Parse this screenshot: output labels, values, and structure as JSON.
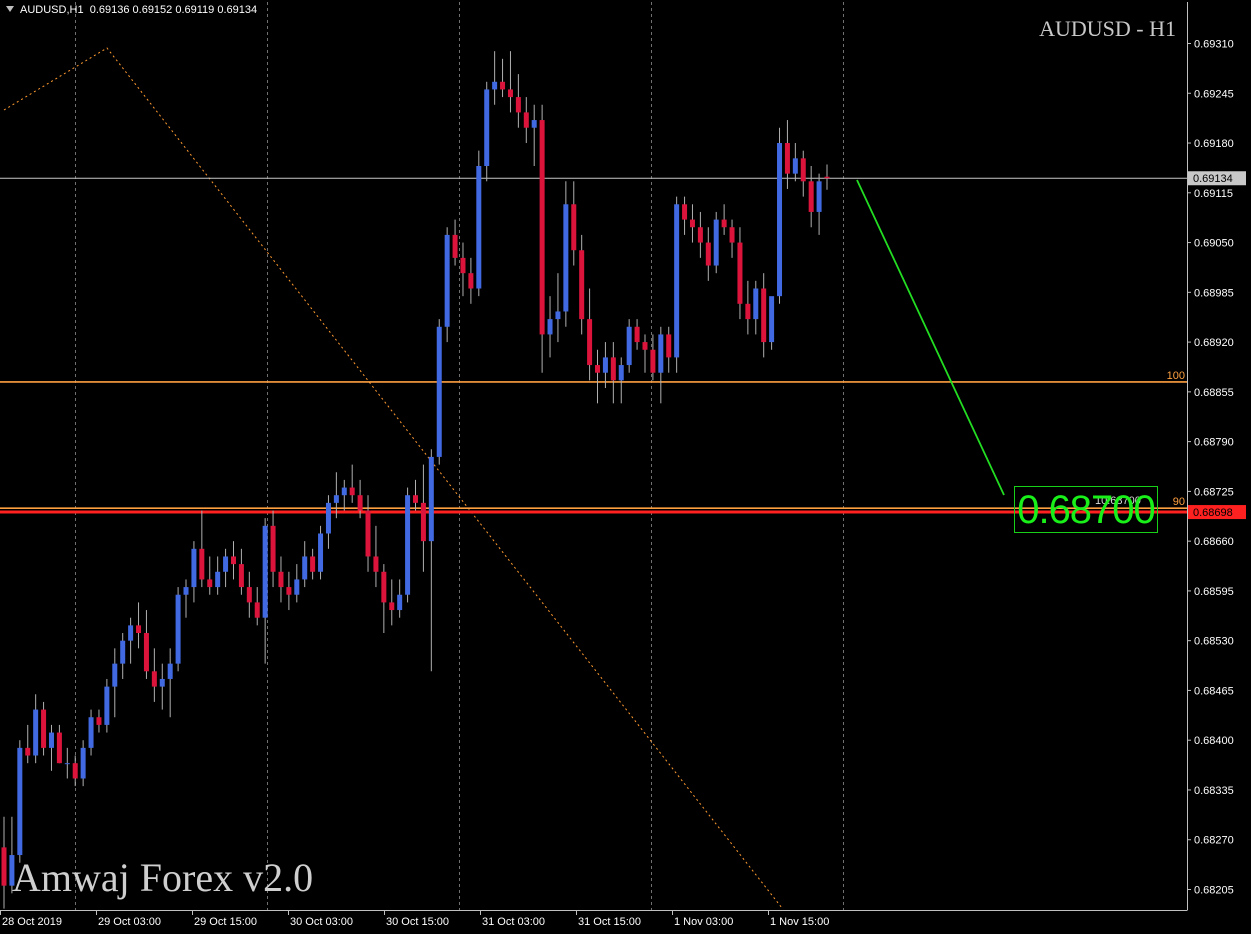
{
  "header": {
    "symbol_timeframe": "AUDUSD,H1",
    "ohlc": "0.69136 0.69152 0.69119 0.69134"
  },
  "chart_title": "AUDUSD - H1",
  "brand": "Amwaj Forex v2.0",
  "target": {
    "value": "0.68700",
    "small_label": "10.68700"
  },
  "colors": {
    "background": "#000000",
    "bull": "#4169e1",
    "bear": "#dc143c",
    "wick": "#b0b0b0",
    "grid": "#707070",
    "fib_line": "#ffa040",
    "red_line": "#ff2020",
    "projection": "#22dd22",
    "dotted_trend": "#ff9a30"
  },
  "chart_data": {
    "type": "candlestick",
    "symbol": "AUDUSD",
    "timeframe": "H1",
    "title": "AUDUSD - H1",
    "ylim": [
      0.68175,
      0.69355
    ],
    "y_ticks": [
      "0.69310",
      "0.69245",
      "0.69180",
      "0.69115",
      "0.69050",
      "0.68985",
      "0.68920",
      "0.68855",
      "0.68790",
      "0.68725",
      "0.68660",
      "0.68595",
      "0.68530",
      "0.68465",
      "0.68400",
      "0.68335",
      "0.68270",
      "0.68205"
    ],
    "x_ticks": [
      "28 Oct 2019",
      "29 Oct 03:00",
      "29 Oct 15:00",
      "30 Oct 03:00",
      "30 Oct 15:00",
      "31 Oct 03:00",
      "31 Oct 15:00",
      "1 Nov 03:00",
      "1 Nov 15:00"
    ],
    "grid": "vertical dotted",
    "bid_price": "0.69134",
    "horizontal_levels": [
      {
        "label": "100",
        "price": 0.68868,
        "color": "#ffa040"
      },
      {
        "label": "90",
        "price": 0.68703,
        "color": "#ffa040"
      },
      {
        "label": "0.68698",
        "price": 0.68698,
        "color": "#ff2020"
      }
    ],
    "candles": [
      {
        "o": 0.6826,
        "h": 0.683,
        "l": 0.6818,
        "c": 0.6821
      },
      {
        "o": 0.6821,
        "h": 0.683,
        "l": 0.682,
        "c": 0.6825
      },
      {
        "o": 0.6825,
        "h": 0.684,
        "l": 0.6824,
        "c": 0.6839
      },
      {
        "o": 0.6839,
        "h": 0.6842,
        "l": 0.6837,
        "c": 0.6838
      },
      {
        "o": 0.6838,
        "h": 0.6846,
        "l": 0.6837,
        "c": 0.6844
      },
      {
        "o": 0.6844,
        "h": 0.6845,
        "l": 0.6838,
        "c": 0.6839
      },
      {
        "o": 0.6839,
        "h": 0.6842,
        "l": 0.6836,
        "c": 0.6841
      },
      {
        "o": 0.6841,
        "h": 0.6842,
        "l": 0.6837,
        "c": 0.6837
      },
      {
        "o": 0.6837,
        "h": 0.6839,
        "l": 0.6835,
        "c": 0.6837
      },
      {
        "o": 0.6837,
        "h": 0.6838,
        "l": 0.6834,
        "c": 0.6835
      },
      {
        "o": 0.6835,
        "h": 0.684,
        "l": 0.6834,
        "c": 0.6839
      },
      {
        "o": 0.6839,
        "h": 0.6844,
        "l": 0.6838,
        "c": 0.6843
      },
      {
        "o": 0.6843,
        "h": 0.6844,
        "l": 0.6841,
        "c": 0.6842
      },
      {
        "o": 0.6842,
        "h": 0.6848,
        "l": 0.6841,
        "c": 0.6847
      },
      {
        "o": 0.6847,
        "h": 0.6852,
        "l": 0.6843,
        "c": 0.685
      },
      {
        "o": 0.685,
        "h": 0.6854,
        "l": 0.6848,
        "c": 0.6853
      },
      {
        "o": 0.6853,
        "h": 0.6856,
        "l": 0.685,
        "c": 0.6855
      },
      {
        "o": 0.6855,
        "h": 0.6858,
        "l": 0.6852,
        "c": 0.6854
      },
      {
        "o": 0.6854,
        "h": 0.6857,
        "l": 0.6848,
        "c": 0.6849
      },
      {
        "o": 0.6849,
        "h": 0.6852,
        "l": 0.6845,
        "c": 0.6847
      },
      {
        "o": 0.6847,
        "h": 0.685,
        "l": 0.6844,
        "c": 0.6848
      },
      {
        "o": 0.6848,
        "h": 0.6852,
        "l": 0.6843,
        "c": 0.685
      },
      {
        "o": 0.685,
        "h": 0.686,
        "l": 0.6849,
        "c": 0.6859
      },
      {
        "o": 0.6859,
        "h": 0.6861,
        "l": 0.6856,
        "c": 0.686
      },
      {
        "o": 0.686,
        "h": 0.6866,
        "l": 0.6858,
        "c": 0.6865
      },
      {
        "o": 0.6865,
        "h": 0.687,
        "l": 0.686,
        "c": 0.6861
      },
      {
        "o": 0.6861,
        "h": 0.6864,
        "l": 0.6859,
        "c": 0.686
      },
      {
        "o": 0.686,
        "h": 0.6864,
        "l": 0.6859,
        "c": 0.6862
      },
      {
        "o": 0.6862,
        "h": 0.6865,
        "l": 0.686,
        "c": 0.6864
      },
      {
        "o": 0.6864,
        "h": 0.6866,
        "l": 0.6861,
        "c": 0.6863
      },
      {
        "o": 0.6863,
        "h": 0.6865,
        "l": 0.6859,
        "c": 0.686
      },
      {
        "o": 0.686,
        "h": 0.6862,
        "l": 0.6856,
        "c": 0.6858
      },
      {
        "o": 0.6858,
        "h": 0.686,
        "l": 0.6855,
        "c": 0.6856
      },
      {
        "o": 0.6856,
        "h": 0.6869,
        "l": 0.685,
        "c": 0.6868
      },
      {
        "o": 0.6868,
        "h": 0.687,
        "l": 0.686,
        "c": 0.6862
      },
      {
        "o": 0.6862,
        "h": 0.6864,
        "l": 0.6858,
        "c": 0.686
      },
      {
        "o": 0.686,
        "h": 0.6862,
        "l": 0.6857,
        "c": 0.6859
      },
      {
        "o": 0.6859,
        "h": 0.6863,
        "l": 0.6858,
        "c": 0.6861
      },
      {
        "o": 0.6861,
        "h": 0.6866,
        "l": 0.686,
        "c": 0.6864
      },
      {
        "o": 0.6864,
        "h": 0.6865,
        "l": 0.6861,
        "c": 0.6862
      },
      {
        "o": 0.6862,
        "h": 0.6868,
        "l": 0.6861,
        "c": 0.6867
      },
      {
        "o": 0.6867,
        "h": 0.6872,
        "l": 0.6865,
        "c": 0.6871
      },
      {
        "o": 0.6871,
        "h": 0.6875,
        "l": 0.6869,
        "c": 0.6872
      },
      {
        "o": 0.6872,
        "h": 0.6874,
        "l": 0.687,
        "c": 0.6873
      },
      {
        "o": 0.6873,
        "h": 0.6876,
        "l": 0.6871,
        "c": 0.6872
      },
      {
        "o": 0.6872,
        "h": 0.6874,
        "l": 0.6869,
        "c": 0.687
      },
      {
        "o": 0.687,
        "h": 0.6872,
        "l": 0.6862,
        "c": 0.6864
      },
      {
        "o": 0.6864,
        "h": 0.6868,
        "l": 0.686,
        "c": 0.6862
      },
      {
        "o": 0.6862,
        "h": 0.6863,
        "l": 0.6854,
        "c": 0.6858
      },
      {
        "o": 0.6858,
        "h": 0.6861,
        "l": 0.6855,
        "c": 0.6857
      },
      {
        "o": 0.6857,
        "h": 0.6861,
        "l": 0.6856,
        "c": 0.6859
      },
      {
        "o": 0.6859,
        "h": 0.6873,
        "l": 0.6858,
        "c": 0.6872
      },
      {
        "o": 0.6872,
        "h": 0.6874,
        "l": 0.687,
        "c": 0.6871
      },
      {
        "o": 0.6871,
        "h": 0.6876,
        "l": 0.6862,
        "c": 0.6866
      },
      {
        "o": 0.6866,
        "h": 0.6878,
        "l": 0.6849,
        "c": 0.6877
      },
      {
        "o": 0.6877,
        "h": 0.6895,
        "l": 0.6876,
        "c": 0.6894
      },
      {
        "o": 0.6894,
        "h": 0.6907,
        "l": 0.6892,
        "c": 0.6906
      },
      {
        "o": 0.6906,
        "h": 0.6908,
        "l": 0.6902,
        "c": 0.6903
      },
      {
        "o": 0.6903,
        "h": 0.6905,
        "l": 0.6898,
        "c": 0.6901
      },
      {
        "o": 0.6901,
        "h": 0.6903,
        "l": 0.6897,
        "c": 0.6899
      },
      {
        "o": 0.6899,
        "h": 0.6917,
        "l": 0.6898,
        "c": 0.6915
      },
      {
        "o": 0.6915,
        "h": 0.6926,
        "l": 0.6913,
        "c": 0.6925
      },
      {
        "o": 0.6925,
        "h": 0.693,
        "l": 0.6923,
        "c": 0.6926
      },
      {
        "o": 0.6926,
        "h": 0.6929,
        "l": 0.6924,
        "c": 0.6925
      },
      {
        "o": 0.6925,
        "h": 0.693,
        "l": 0.6922,
        "c": 0.6924
      },
      {
        "o": 0.6924,
        "h": 0.6927,
        "l": 0.692,
        "c": 0.6922
      },
      {
        "o": 0.6922,
        "h": 0.6924,
        "l": 0.6918,
        "c": 0.692
      },
      {
        "o": 0.692,
        "h": 0.6923,
        "l": 0.6915,
        "c": 0.6921
      },
      {
        "o": 0.6921,
        "h": 0.6923,
        "l": 0.6888,
        "c": 0.6893
      },
      {
        "o": 0.6893,
        "h": 0.6898,
        "l": 0.689,
        "c": 0.6895
      },
      {
        "o": 0.6895,
        "h": 0.6901,
        "l": 0.6892,
        "c": 0.6896
      },
      {
        "o": 0.6896,
        "h": 0.6913,
        "l": 0.6894,
        "c": 0.691
      },
      {
        "o": 0.691,
        "h": 0.6913,
        "l": 0.6902,
        "c": 0.6904
      },
      {
        "o": 0.6904,
        "h": 0.6906,
        "l": 0.6893,
        "c": 0.6895
      },
      {
        "o": 0.6895,
        "h": 0.6899,
        "l": 0.6887,
        "c": 0.6889
      },
      {
        "o": 0.6889,
        "h": 0.6891,
        "l": 0.6884,
        "c": 0.6888
      },
      {
        "o": 0.6888,
        "h": 0.6892,
        "l": 0.6886,
        "c": 0.689
      },
      {
        "o": 0.689,
        "h": 0.6892,
        "l": 0.6884,
        "c": 0.6887
      },
      {
        "o": 0.6887,
        "h": 0.689,
        "l": 0.6884,
        "c": 0.6889
      },
      {
        "o": 0.6889,
        "h": 0.6895,
        "l": 0.6888,
        "c": 0.6894
      },
      {
        "o": 0.6894,
        "h": 0.6895,
        "l": 0.6891,
        "c": 0.6892
      },
      {
        "o": 0.6892,
        "h": 0.6893,
        "l": 0.6888,
        "c": 0.6891
      },
      {
        "o": 0.6891,
        "h": 0.6893,
        "l": 0.6887,
        "c": 0.6888
      },
      {
        "o": 0.6888,
        "h": 0.6894,
        "l": 0.6884,
        "c": 0.6893
      },
      {
        "o": 0.6893,
        "h": 0.6894,
        "l": 0.6888,
        "c": 0.689
      },
      {
        "o": 0.689,
        "h": 0.6911,
        "l": 0.6888,
        "c": 0.691
      },
      {
        "o": 0.691,
        "h": 0.6911,
        "l": 0.6906,
        "c": 0.6908
      },
      {
        "o": 0.6908,
        "h": 0.691,
        "l": 0.6905,
        "c": 0.6907
      },
      {
        "o": 0.6907,
        "h": 0.6909,
        "l": 0.6903,
        "c": 0.6905
      },
      {
        "o": 0.6905,
        "h": 0.6907,
        "l": 0.69,
        "c": 0.6902
      },
      {
        "o": 0.6902,
        "h": 0.6909,
        "l": 0.6901,
        "c": 0.6908
      },
      {
        "o": 0.6908,
        "h": 0.691,
        "l": 0.6906,
        "c": 0.6907
      },
      {
        "o": 0.6907,
        "h": 0.6908,
        "l": 0.6903,
        "c": 0.6905
      },
      {
        "o": 0.6905,
        "h": 0.6907,
        "l": 0.6895,
        "c": 0.6897
      },
      {
        "o": 0.6897,
        "h": 0.69,
        "l": 0.6893,
        "c": 0.6895
      },
      {
        "o": 0.6895,
        "h": 0.69,
        "l": 0.6893,
        "c": 0.6899
      },
      {
        "o": 0.6899,
        "h": 0.6901,
        "l": 0.689,
        "c": 0.6892
      },
      {
        "o": 0.6892,
        "h": 0.6896,
        "l": 0.6891,
        "c": 0.6898
      },
      {
        "o": 0.6898,
        "h": 0.692,
        "l": 0.6897,
        "c": 0.6918
      },
      {
        "o": 0.6918,
        "h": 0.6921,
        "l": 0.6912,
        "c": 0.6914
      },
      {
        "o": 0.6914,
        "h": 0.6918,
        "l": 0.6913,
        "c": 0.6916
      },
      {
        "o": 0.6916,
        "h": 0.6917,
        "l": 0.6911,
        "c": 0.6913
      },
      {
        "o": 0.6913,
        "h": 0.6915,
        "l": 0.6907,
        "c": 0.6909
      },
      {
        "o": 0.6909,
        "h": 0.6914,
        "l": 0.6906,
        "c": 0.6913
      },
      {
        "o": 0.69136,
        "h": 0.69152,
        "l": 0.69119,
        "c": 0.69134
      }
    ]
  }
}
